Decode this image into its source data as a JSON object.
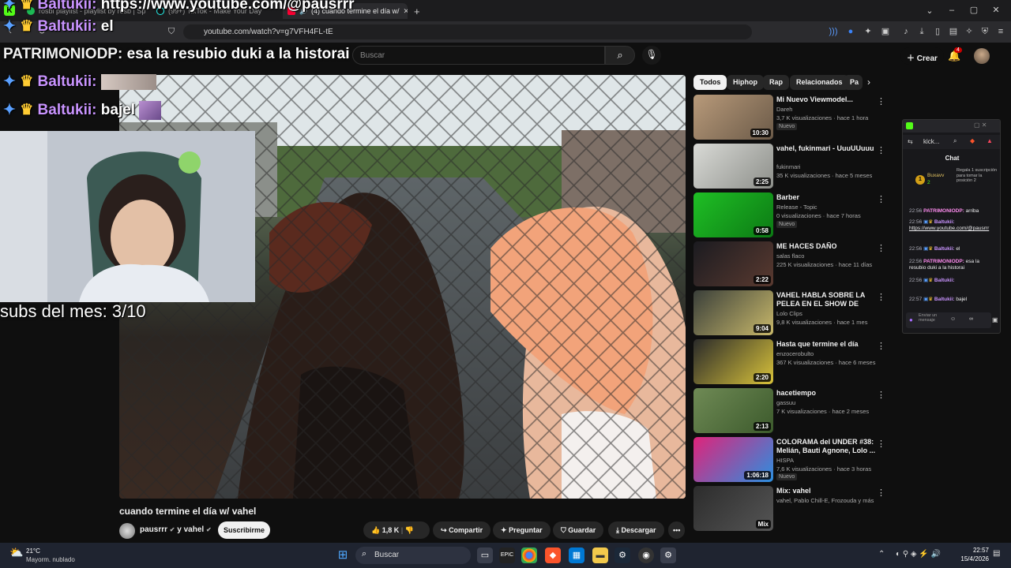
{
  "browser": {
    "tabs": [
      {
        "label": "rosbi playlist - playlist by rosb | Spoti",
        "active": false
      },
      {
        "label": "(99+) TikTok - Make Your Day",
        "active": false
      },
      {
        "label": "(4) cuando termine el día w/",
        "active": true
      }
    ],
    "new_tab": "+",
    "url": "youtube.com/watch?v=g7VFH4FL-tE"
  },
  "youtube": {
    "search_placeholder": "Buscar",
    "create_label": "Crear",
    "notif_count": "4",
    "video": {
      "title": "cuando termine el día w/ vahel",
      "channel": "pausrrr",
      "channel_join": "y vahel",
      "subscribe_label": "Suscribirme",
      "likes": "1,8 K",
      "share_label": "Compartir",
      "ask_label": "Preguntar",
      "save_label": "Guardar",
      "download_label": "Descargar"
    },
    "chips": [
      "Todos",
      "Hiphop",
      "Rap",
      "Relacionados",
      "Pa"
    ],
    "recommendations": [
      {
        "title": "Mi Nuevo Viewmodel...",
        "channel": "Dareh",
        "meta": "3,7 K visualizaciones · hace 1 hora",
        "badge": "Nuevo",
        "duration": "10:30",
        "colors": [
          "#b89a7a",
          "#6b5a48"
        ]
      },
      {
        "title": "vahel, fukinmari - UuuUUuuu",
        "channel": "fukinmari",
        "meta": "35 K visualizaciones · hace 5 meses",
        "badge": "",
        "duration": "2:25",
        "colors": [
          "#d9dad6",
          "#8d8f8a"
        ]
      },
      {
        "title": "Barber",
        "channel": "Release - Topic",
        "meta": "0 visualizaciones · hace 7 horas",
        "badge": "Nuevo",
        "duration": "0:58",
        "colors": [
          "#1fbf25",
          "#0c7a14"
        ]
      },
      {
        "title": "ME HACES DAÑO",
        "channel": "salas flaco",
        "meta": "225 K visualizaciones · hace 11 días",
        "badge": "",
        "duration": "2:22",
        "colors": [
          "#1b1b20",
          "#5a3a30"
        ]
      },
      {
        "title": "VAHEL HABLA SOBRE LA PELEA EN EL SHOW DE CERO*",
        "channel": "Lolo Clips",
        "meta": "9,8 K visualizaciones · hace 1 mes",
        "badge": "",
        "duration": "9:04",
        "colors": [
          "#3a3f3a",
          "#c8b86a"
        ]
      },
      {
        "title": "Hasta que termine el día",
        "channel": "enzocerobulto",
        "meta": "367 K visualizaciones · hace 6 meses",
        "badge": "",
        "duration": "2:20",
        "colors": [
          "#2a2a2a",
          "#d8c23a"
        ]
      },
      {
        "title": "hacetiempo",
        "channel": "gassuu",
        "meta": "7 K visualizaciones · hace 2 meses",
        "badge": "",
        "duration": "2:13",
        "colors": [
          "#6f8a55",
          "#3c5a2c"
        ]
      },
      {
        "title": "COLORAMA del UNDER #38: Melián, Bauti Agnone, Lolo ...",
        "channel": "HISPA",
        "meta": "7,6 K visualizaciones · hace 3 horas",
        "badge": "Nuevo",
        "duration": "1:06:18",
        "colors": [
          "#e0237a",
          "#2b8fe0"
        ]
      },
      {
        "title": "Mix: vahel",
        "channel": "vahel, Pablo Chill-E, Frozouda y más",
        "meta": "",
        "badge": "",
        "duration": "Mix",
        "colors": [
          "#2c2c2c",
          "#555"
        ]
      }
    ]
  },
  "overlay": {
    "chat_lines": [
      {
        "user": "Baltukii:",
        "text": "https://www.youtube.com/@pausrrr"
      },
      {
        "user": "Baltukii:",
        "text": "el"
      },
      {
        "user": "PATRIMONIODP:",
        "text": "esa la resubio duki a la historai"
      },
      {
        "user": "Baltukii:",
        "text": ""
      },
      {
        "user": "Baltukii:",
        "text": "bajel"
      }
    ],
    "subs_text": "subs del mes: 3/10"
  },
  "kick": {
    "title": "kick...",
    "chat_label": "Chat",
    "gift_user": "Buxavv",
    "gift_count": "2",
    "gift_text": "Regala 1 suscripción para tomar la posición 2",
    "messages": [
      {
        "time": "22:56",
        "user": "PATRIMONIODP:",
        "text": "arriba",
        "pink": true
      },
      {
        "time": "22:56",
        "user": "Baltukii:",
        "text": "https://www.youtube.com/@pausrrr",
        "pink": false
      },
      {
        "time": "22:56",
        "user": "Baltukii:",
        "text": "el",
        "pink": false
      },
      {
        "time": "22:56",
        "user": "PATRIMONIODP:",
        "text": "esa la resubio duki a la historai",
        "pink": true
      },
      {
        "time": "22:56",
        "user": "Baltukii:",
        "text": "",
        "pink": false
      },
      {
        "time": "22:57",
        "user": "Baltukii:",
        "text": "bajel",
        "pink": false
      }
    ],
    "send_placeholder": "Enviar un mensaje"
  },
  "taskbar": {
    "weather_temp": "21°C",
    "weather_desc": "Mayorm. nublado",
    "search_label": "Buscar",
    "time": "22:57",
    "date": "15/4/2026"
  }
}
